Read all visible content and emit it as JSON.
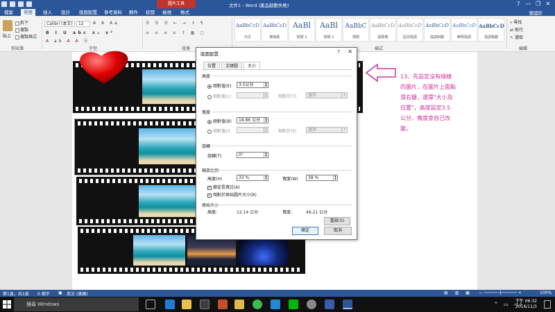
{
  "window": {
    "title": "文件1 - Word (產品啟動失敗)",
    "context_tab": "圖片工具",
    "controls": [
      "?",
      "—",
      "❐",
      "✕"
    ]
  },
  "tabs": [
    "檔案",
    "常用",
    "插入",
    "設計",
    "版面配置",
    "參考資料",
    "郵件",
    "校閱",
    "檢視",
    "格式"
  ],
  "active_tab": "常用",
  "user": "張誼珍",
  "ribbon": {
    "clipboard": {
      "paste": "貼上",
      "cut": "剪下",
      "copy": "複製",
      "format_painter": "複製格式",
      "label": "剪貼簿"
    },
    "font": {
      "name": "Calibri (本文)",
      "size": "12",
      "label": "字型"
    },
    "paragraph": {
      "label": "段落"
    },
    "styles": {
      "label": "樣式",
      "items": [
        {
          "preview": "AaBbCcD",
          "name": "內文"
        },
        {
          "preview": "AaBbCcD",
          "name": "無間距"
        },
        {
          "preview": "AaBl",
          "name": "標題 1"
        },
        {
          "preview": "AaBl",
          "name": "標題 2"
        },
        {
          "preview": "AaBbC",
          "name": "標題"
        },
        {
          "preview": "AaBbCcD",
          "name": "副標題"
        },
        {
          "preview": "AaBbCcD",
          "name": "區別強調"
        },
        {
          "preview": "AaBbCcD",
          "name": "強調斜體"
        },
        {
          "preview": "AaBbCcD",
          "name": "鮮明強調"
        },
        {
          "preview": "AaBbCcD",
          "name": "強調粗體"
        }
      ]
    },
    "editing": {
      "find": "尋找",
      "replace": "取代",
      "select": "選取",
      "label": "編輯"
    }
  },
  "dialog": {
    "title": "版面配置",
    "help": "?",
    "close": "✕",
    "tabs": [
      "位置",
      "文繞圖",
      "大小"
    ],
    "active_tab": "大小",
    "height_section": {
      "label": "高度",
      "absolute_label": "絕對值(E)",
      "absolute_value": "3.5公分",
      "relative_label": "相對值(L)",
      "relative_of_label": "相對於(T)",
      "relative_of_value": "邊界"
    },
    "width_section": {
      "label": "寬度",
      "absolute_label": "絕對值(B)",
      "absolute_value": "18.86 公分",
      "relative_label": "相對值(I)",
      "relative_of_label": "相對於(E)",
      "relative_of_value": "邊界"
    },
    "rotate_section": {
      "label": "旋轉",
      "rotation_label": "旋轉(T)",
      "rotation_value": "0°"
    },
    "scale_section": {
      "label": "縮放比例",
      "height_label": "高度(H)",
      "height_value": "33 %",
      "width_label": "寬度(W)",
      "width_value": "38 %",
      "lock_aspect_label": "鎖定長寬比(A)",
      "relative_original_label": "相對於原始圖片大小(R)"
    },
    "original_section": {
      "label": "原始大小",
      "height_label": "高度:",
      "height_value": "12.14 公分",
      "width_label": "寬度:",
      "width_value": "49.21 公分"
    },
    "reset_button": "重設(S)",
    "ok_button": "確定",
    "cancel_button": "取消"
  },
  "annotation": {
    "lines": [
      "13、先設定沒有綠線",
      "的圖片，在圖片上面點",
      "滑右鍵，選擇\"大小及",
      "位置\"，高度設定3.5",
      "公分，寬度會自己改",
      "變。"
    ],
    "color": "#d0309a"
  },
  "status": {
    "page": "第1頁，共1頁",
    "words": "0 個字",
    "language": "英文 (美國)",
    "zoom": "100%"
  },
  "taskbar": {
    "search_placeholder": "搜尋 Windows",
    "time": "下午 06:32",
    "date": "2016/11/3"
  },
  "colors": {
    "word_blue": "#2b579a",
    "context_red": "#c0352b",
    "note_pink": "#d0309a"
  }
}
